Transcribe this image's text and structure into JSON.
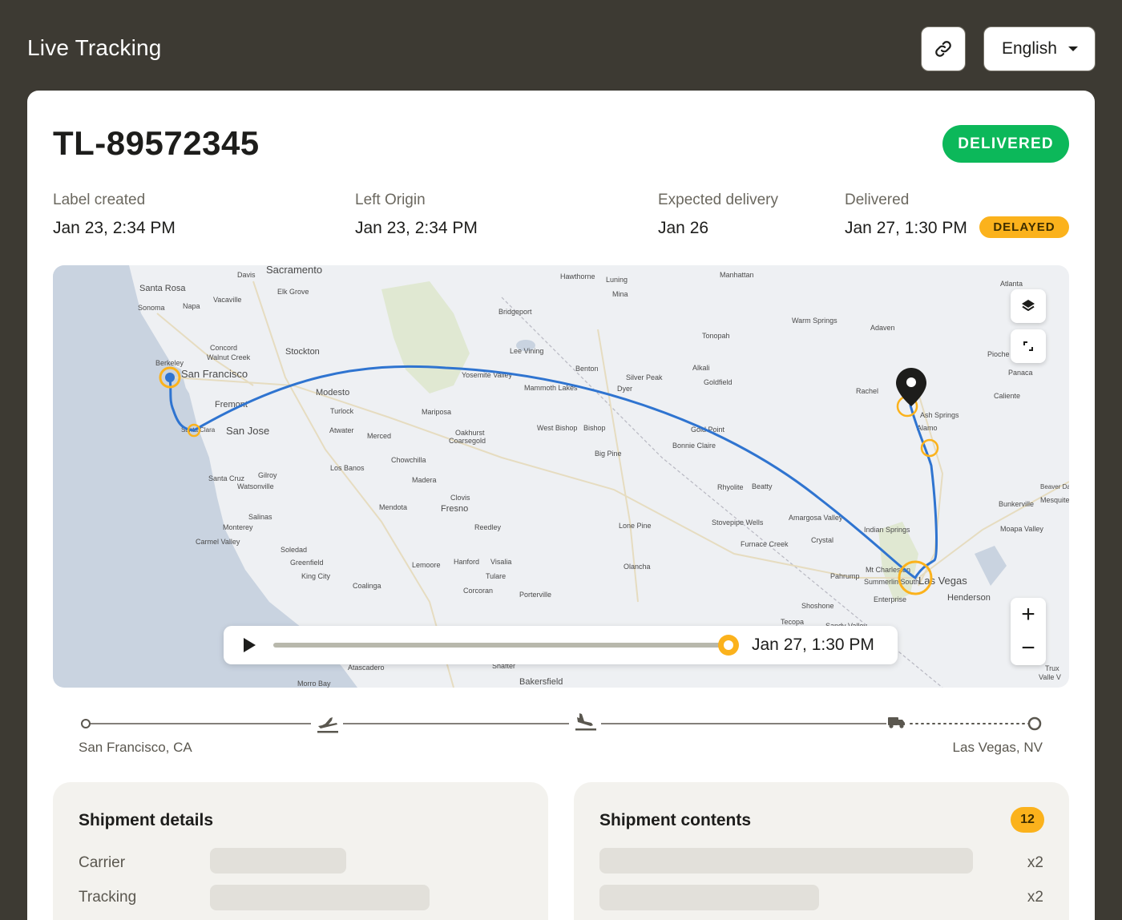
{
  "header": {
    "title": "Live Tracking",
    "language": "English",
    "link_icon": "link-icon"
  },
  "shipment": {
    "tracking_id": "TL-89572345",
    "status": "DELIVERED",
    "milestones": [
      {
        "label": "Label created",
        "value": "Jan 23, 2:34 PM"
      },
      {
        "label": "Left Origin",
        "value": "Jan 23, 2:34 PM"
      },
      {
        "label": "Expected delivery",
        "value": "Jan 26"
      },
      {
        "label": "Delivered",
        "value": "Jan 27, 1:30 PM"
      }
    ],
    "delay_badge": "DELAYED"
  },
  "map": {
    "cities": [
      "Sacramento",
      "Santa Rosa",
      "Davis",
      "Elk Grove",
      "Vacaville",
      "Sonoma",
      "Napa",
      "Concord",
      "Walnut Creek",
      "Stockton",
      "Berkeley",
      "San Francisco",
      "Fremont",
      "Modesto",
      "San Jose",
      "Santa Clara",
      "Turlock",
      "Atwater",
      "Merced",
      "Los Banos",
      "Chowchilla",
      "Madera",
      "Gilroy",
      "Santa Cruz",
      "Watsonville",
      "Salinas",
      "Monterey",
      "Carmel Valley",
      "Soledad",
      "Greenfield",
      "King City",
      "Mendota",
      "Fresno",
      "Clovis",
      "Reedley",
      "Hanford",
      "Visalia",
      "Tulare",
      "Lemoore",
      "Coalinga",
      "Corcoran",
      "Porterville",
      "Yosemite Valley",
      "Mariposa",
      "Oakhurst",
      "Coarsegold",
      "Mammoth Lakes",
      "Lee Vining",
      "Bridgeport",
      "Hawthorne",
      "Luning",
      "Mina",
      "Benton",
      "Bishop",
      "West Bishop",
      "Big Pine",
      "Lone Pine",
      "Olancha",
      "Tonopah",
      "Silver Peak",
      "Alkali",
      "Goldfield",
      "Dyer",
      "Gold Point",
      "Bonnie Claire",
      "Rhyolite",
      "Beatty",
      "Amargosa Valley",
      "Stovepipe Wells",
      "Furnace Creek",
      "Crystal",
      "Manhattan",
      "Warm Springs",
      "Adaven",
      "Rachel",
      "Alamo",
      "Ash Springs",
      "Indian Springs",
      "Mt Charleston",
      "Pahrump",
      "Summerlin South",
      "Enterprise",
      "Las Vegas",
      "Henderson",
      "Shoshone",
      "Tecopa",
      "Sandy Valley",
      "Atlanta",
      "Pioche",
      "Panaca",
      "Caliente",
      "Bunkerville",
      "Mesquite",
      "Moapa Valley",
      "Beaver Dam",
      "Bakersfield",
      "Atascadero",
      "Morro Bay",
      "Shafter",
      "Trux",
      "Valle V"
    ],
    "layers_icon": "layers-icon",
    "fullscreen_icon": "fullscreen-icon",
    "zoom_in": "+",
    "zoom_out": "−",
    "player_time": "Jan 27, 1:30 PM",
    "progress": 1.0,
    "colors": {
      "route": "#2f74d0",
      "stop": "#fbb21c",
      "delivered": "#0cb85a"
    }
  },
  "route": {
    "origin": "San Francisco, CA",
    "destination": "Las Vegas, NV"
  },
  "details": {
    "title": "Shipment details",
    "rows": [
      {
        "label": "Carrier"
      },
      {
        "label": "Tracking"
      }
    ]
  },
  "contents": {
    "title": "Shipment contents",
    "count": "12",
    "items": [
      {
        "qty": "x2"
      },
      {
        "qty": "x2"
      }
    ]
  }
}
